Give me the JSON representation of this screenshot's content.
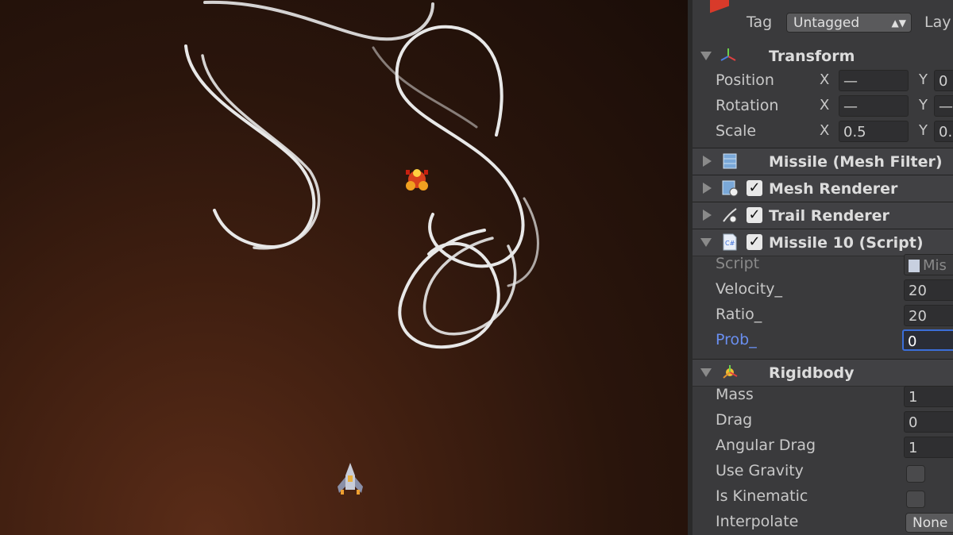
{
  "inspector": {
    "tag_label": "Tag",
    "tag_value": "Untagged",
    "layer_label": "Lay",
    "transform": {
      "title": "Transform",
      "position_label": "Position",
      "rotation_label": "Rotation",
      "scale_label": "Scale",
      "position": {
        "x_label": "X",
        "x": "—",
        "y_label": "Y",
        "y": "0"
      },
      "rotation": {
        "x_label": "X",
        "x": "—",
        "y_label": "Y",
        "y": "—"
      },
      "scale": {
        "x_label": "X",
        "x": "0.5",
        "y_label": "Y",
        "y": "0."
      }
    },
    "components": [
      {
        "title": "Missile (Mesh Filter)",
        "checked": false
      },
      {
        "title": "Mesh Renderer",
        "checked": true
      },
      {
        "title": "Trail Renderer",
        "checked": true
      }
    ],
    "script": {
      "title": "Missile 10 (Script)",
      "checked": true,
      "script_label": "Script",
      "script_value": "Mis",
      "velocity_label": "Velocity_",
      "velocity": "20",
      "ratio_label": "Ratio_",
      "ratio": "20",
      "prob_label": "Prob_",
      "prob": "0"
    },
    "rigidbody": {
      "title": "Rigidbody",
      "mass_label": "Mass",
      "mass": "1",
      "drag_label": "Drag",
      "drag": "0",
      "angular_drag_label": "Angular Drag",
      "angular_drag": "1",
      "use_gravity_label": "Use Gravity",
      "use_gravity": false,
      "is_kinematic_label": "Is Kinematic",
      "is_kinematic": false,
      "interpolate_label": "Interpolate",
      "interpolate": "None"
    },
    "checkmark": "✓"
  },
  "colors": {
    "accent": "#3b6ed8",
    "trail": "#e6e6e6",
    "panel": "#3a3a3c"
  }
}
